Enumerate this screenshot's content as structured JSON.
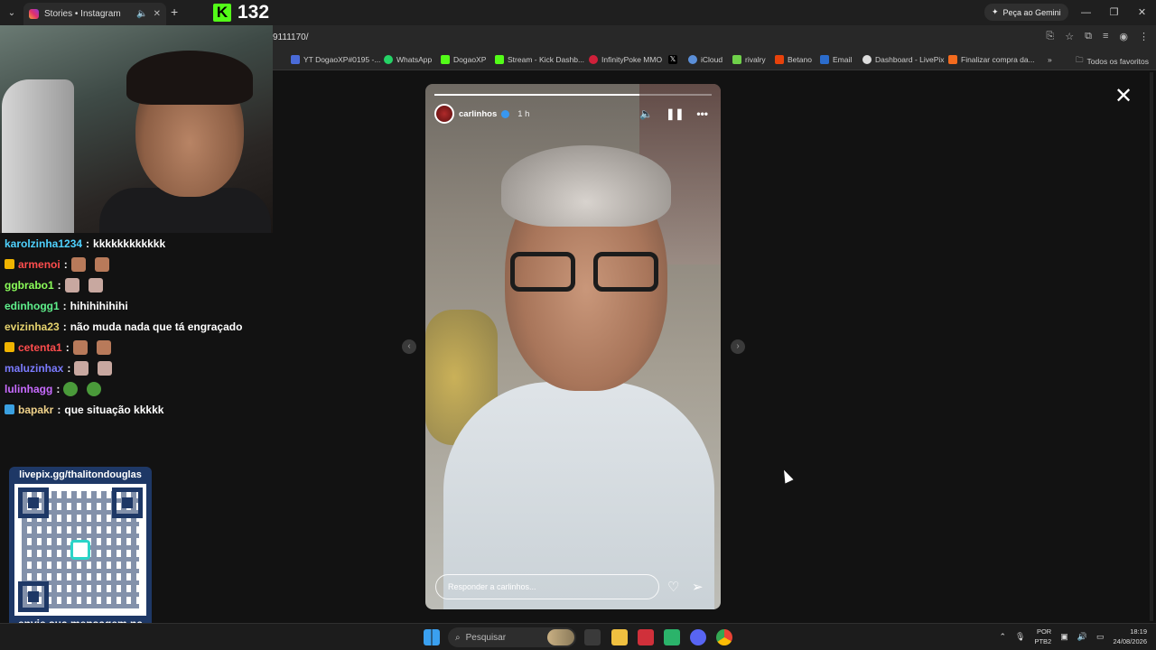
{
  "browser": {
    "tab_title": "Stories • Instagram",
    "url": "9111170/",
    "gemini_label": "Peça ao Gemini",
    "kick_count": "132",
    "kick_logo": "K",
    "bookmarks": [
      "YT DogaoXP#0195 -...",
      "WhatsApp",
      "DogaoXP",
      "Stream - Kick Dashb...",
      "InfinityPoke MMO",
      "",
      "iCloud",
      "rivalry",
      "Betano",
      "Email",
      "Dashboard - LivePix",
      "Finalizar compra da..."
    ],
    "all_favorites": "Todos os favoritos"
  },
  "chat": [
    {
      "badge": "",
      "user": "karolzinha1234",
      "color": "#4fd2ff",
      "msg": "kkkkkkkkkkkk"
    },
    {
      "badge": "crown",
      "user": "armenoi",
      "color": "#ff4d4d",
      "msg": ""
    },
    {
      "badge": "",
      "user": "ggbrabo1",
      "color": "#8cff5a",
      "msg": ""
    },
    {
      "badge": "",
      "user": "edinhogg1",
      "color": "#5ff08c",
      "msg": "hihihihihihi"
    },
    {
      "badge": "",
      "user": "evizinha23",
      "color": "#e6d36e",
      "msg": "não muda nada que tá engraçado"
    },
    {
      "badge": "crown",
      "user": "cetenta1",
      "color": "#ff4d4d",
      "msg": ""
    },
    {
      "badge": "",
      "user": "maluzinhax",
      "color": "#7b7bff",
      "msg": ""
    },
    {
      "badge": "",
      "user": "lulinhagg",
      "color": "#c86bff",
      "msg": ""
    },
    {
      "badge": "prime",
      "user": "bapakr",
      "color": "#f0d28a",
      "msg": "que situação kkkkk"
    }
  ],
  "livepix": {
    "url": "livepix.gg/thalitondouglas",
    "cta": "envie sua mensagem na live via pix!"
  },
  "story": {
    "username": "carlinhos",
    "time": "1 h",
    "progress": 0.74,
    "reply_placeholder": "Responder a carlinhos..."
  },
  "taskbar": {
    "search": "Pesquisar",
    "lang_top": "POR",
    "lang_bottom": "PTB2",
    "time": "18:19",
    "date": "24/08/2026"
  },
  "icons": {
    "menu": "chevron-down-icon",
    "audio": "speaker-icon",
    "close_tab": "close-icon",
    "new_tab": "plus-icon",
    "story_mute": "speaker-icon",
    "story_pause": "pause-icon",
    "story_more": "more-icon",
    "like": "heart-icon",
    "share": "send-icon",
    "close_viewer": "close-icon"
  },
  "colors": {
    "kick_green": "#53fc18",
    "livepix_blue": "#1e3866",
    "instagram_verified": "#3897f0"
  }
}
